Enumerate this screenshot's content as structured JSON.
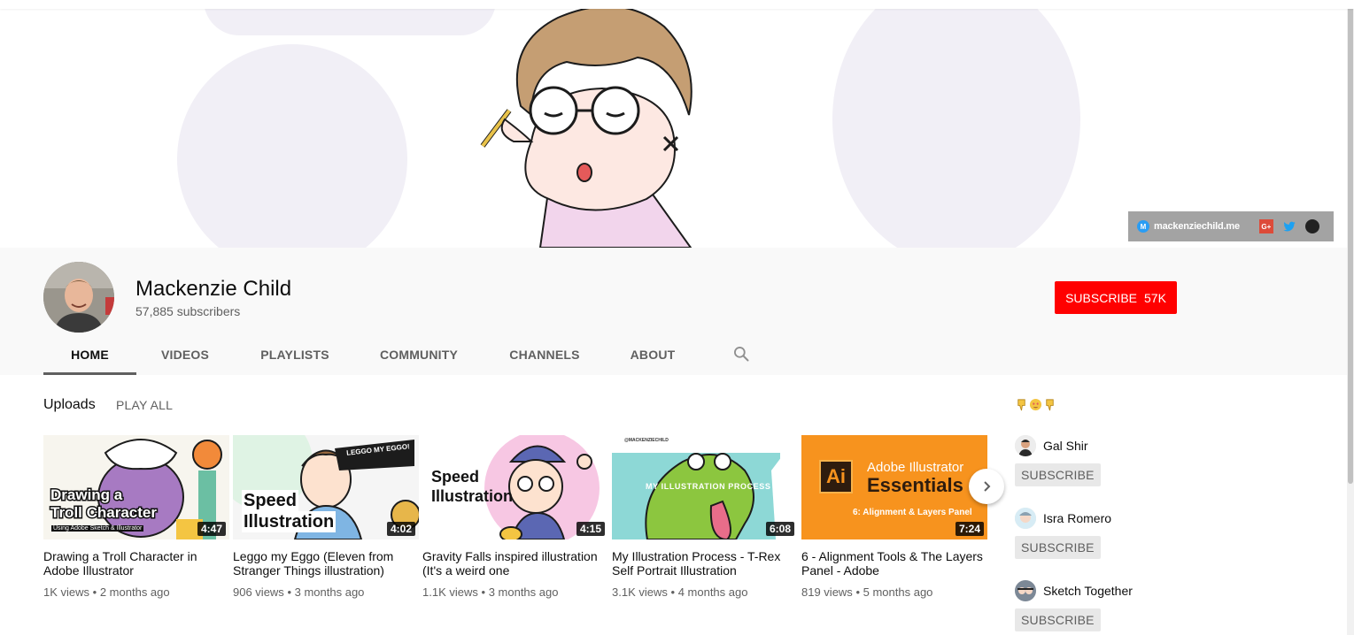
{
  "banner": {
    "website_text": "mackenziechild.me",
    "link_icons": [
      "website-icon",
      "google-plus-icon",
      "twitter-icon",
      "github-icon"
    ],
    "gplus_text": "G+"
  },
  "channel": {
    "name": "Mackenzie Child",
    "subscribers": "57,885 subscribers",
    "subscribe_label": "SUBSCRIBE",
    "subscribe_count": "57K"
  },
  "tabs": [
    {
      "label": "HOME",
      "active": true
    },
    {
      "label": "VIDEOS",
      "active": false
    },
    {
      "label": "PLAYLISTS",
      "active": false
    },
    {
      "label": "COMMUNITY",
      "active": false
    },
    {
      "label": "CHANNELS",
      "active": false
    },
    {
      "label": "ABOUT",
      "active": false
    }
  ],
  "uploads": {
    "title": "Uploads",
    "play_all": "PLAY ALL",
    "videos": [
      {
        "title": "Drawing a Troll Character in Adobe Illustrator",
        "views": "1K views",
        "age": "2 months ago",
        "duration": "4:47",
        "thumb_text": [
          "Drawing a",
          "Troll Character",
          "Using Adobe Sketch & Illustrator"
        ]
      },
      {
        "title": "Leggo my Eggo (Eleven from Stranger Things illustration)",
        "views": "906 views",
        "age": "3 months ago",
        "duration": "4:02",
        "thumb_text": [
          "Speed",
          "Illustration",
          "LEGGO MY EGGO!"
        ]
      },
      {
        "title": "Gravity Falls inspired illustration (It's a weird one",
        "views": "1.1K views",
        "age": "3 months ago",
        "duration": "4:15",
        "thumb_text": [
          "Speed",
          "Illustration"
        ]
      },
      {
        "title": "My Illustration Process - T-Rex Self Portrait Illustration",
        "views": "3.1K views",
        "age": "4 months ago",
        "duration": "6:08",
        "thumb_text": [
          "MY ILLUSTRATION PROCESS",
          "@MACKENZIECHILD"
        ]
      },
      {
        "title": "6 - Alignment Tools & The Layers Panel - Adobe",
        "views": "819 views",
        "age": "5 months ago",
        "duration": "7:24",
        "thumb_text": [
          "Ai",
          "Adobe Illustrator",
          "Essentials",
          "6: Alignment & Layers Panel"
        ]
      }
    ],
    "separator": "•"
  },
  "featured": {
    "emojis": [
      "point-down-icon",
      "star-struck-icon",
      "point-down-icon"
    ],
    "channels": [
      {
        "name": "Gal Shir",
        "subscribe": "SUBSCRIBE"
      },
      {
        "name": "Isra Romero",
        "subscribe": "SUBSCRIBE"
      },
      {
        "name": "Sketch Together",
        "subscribe": "SUBSCRIBE"
      }
    ]
  },
  "colors": {
    "accent": "#ff0000",
    "text_secondary": "#606060",
    "header_bg": "#f9f9f9"
  }
}
